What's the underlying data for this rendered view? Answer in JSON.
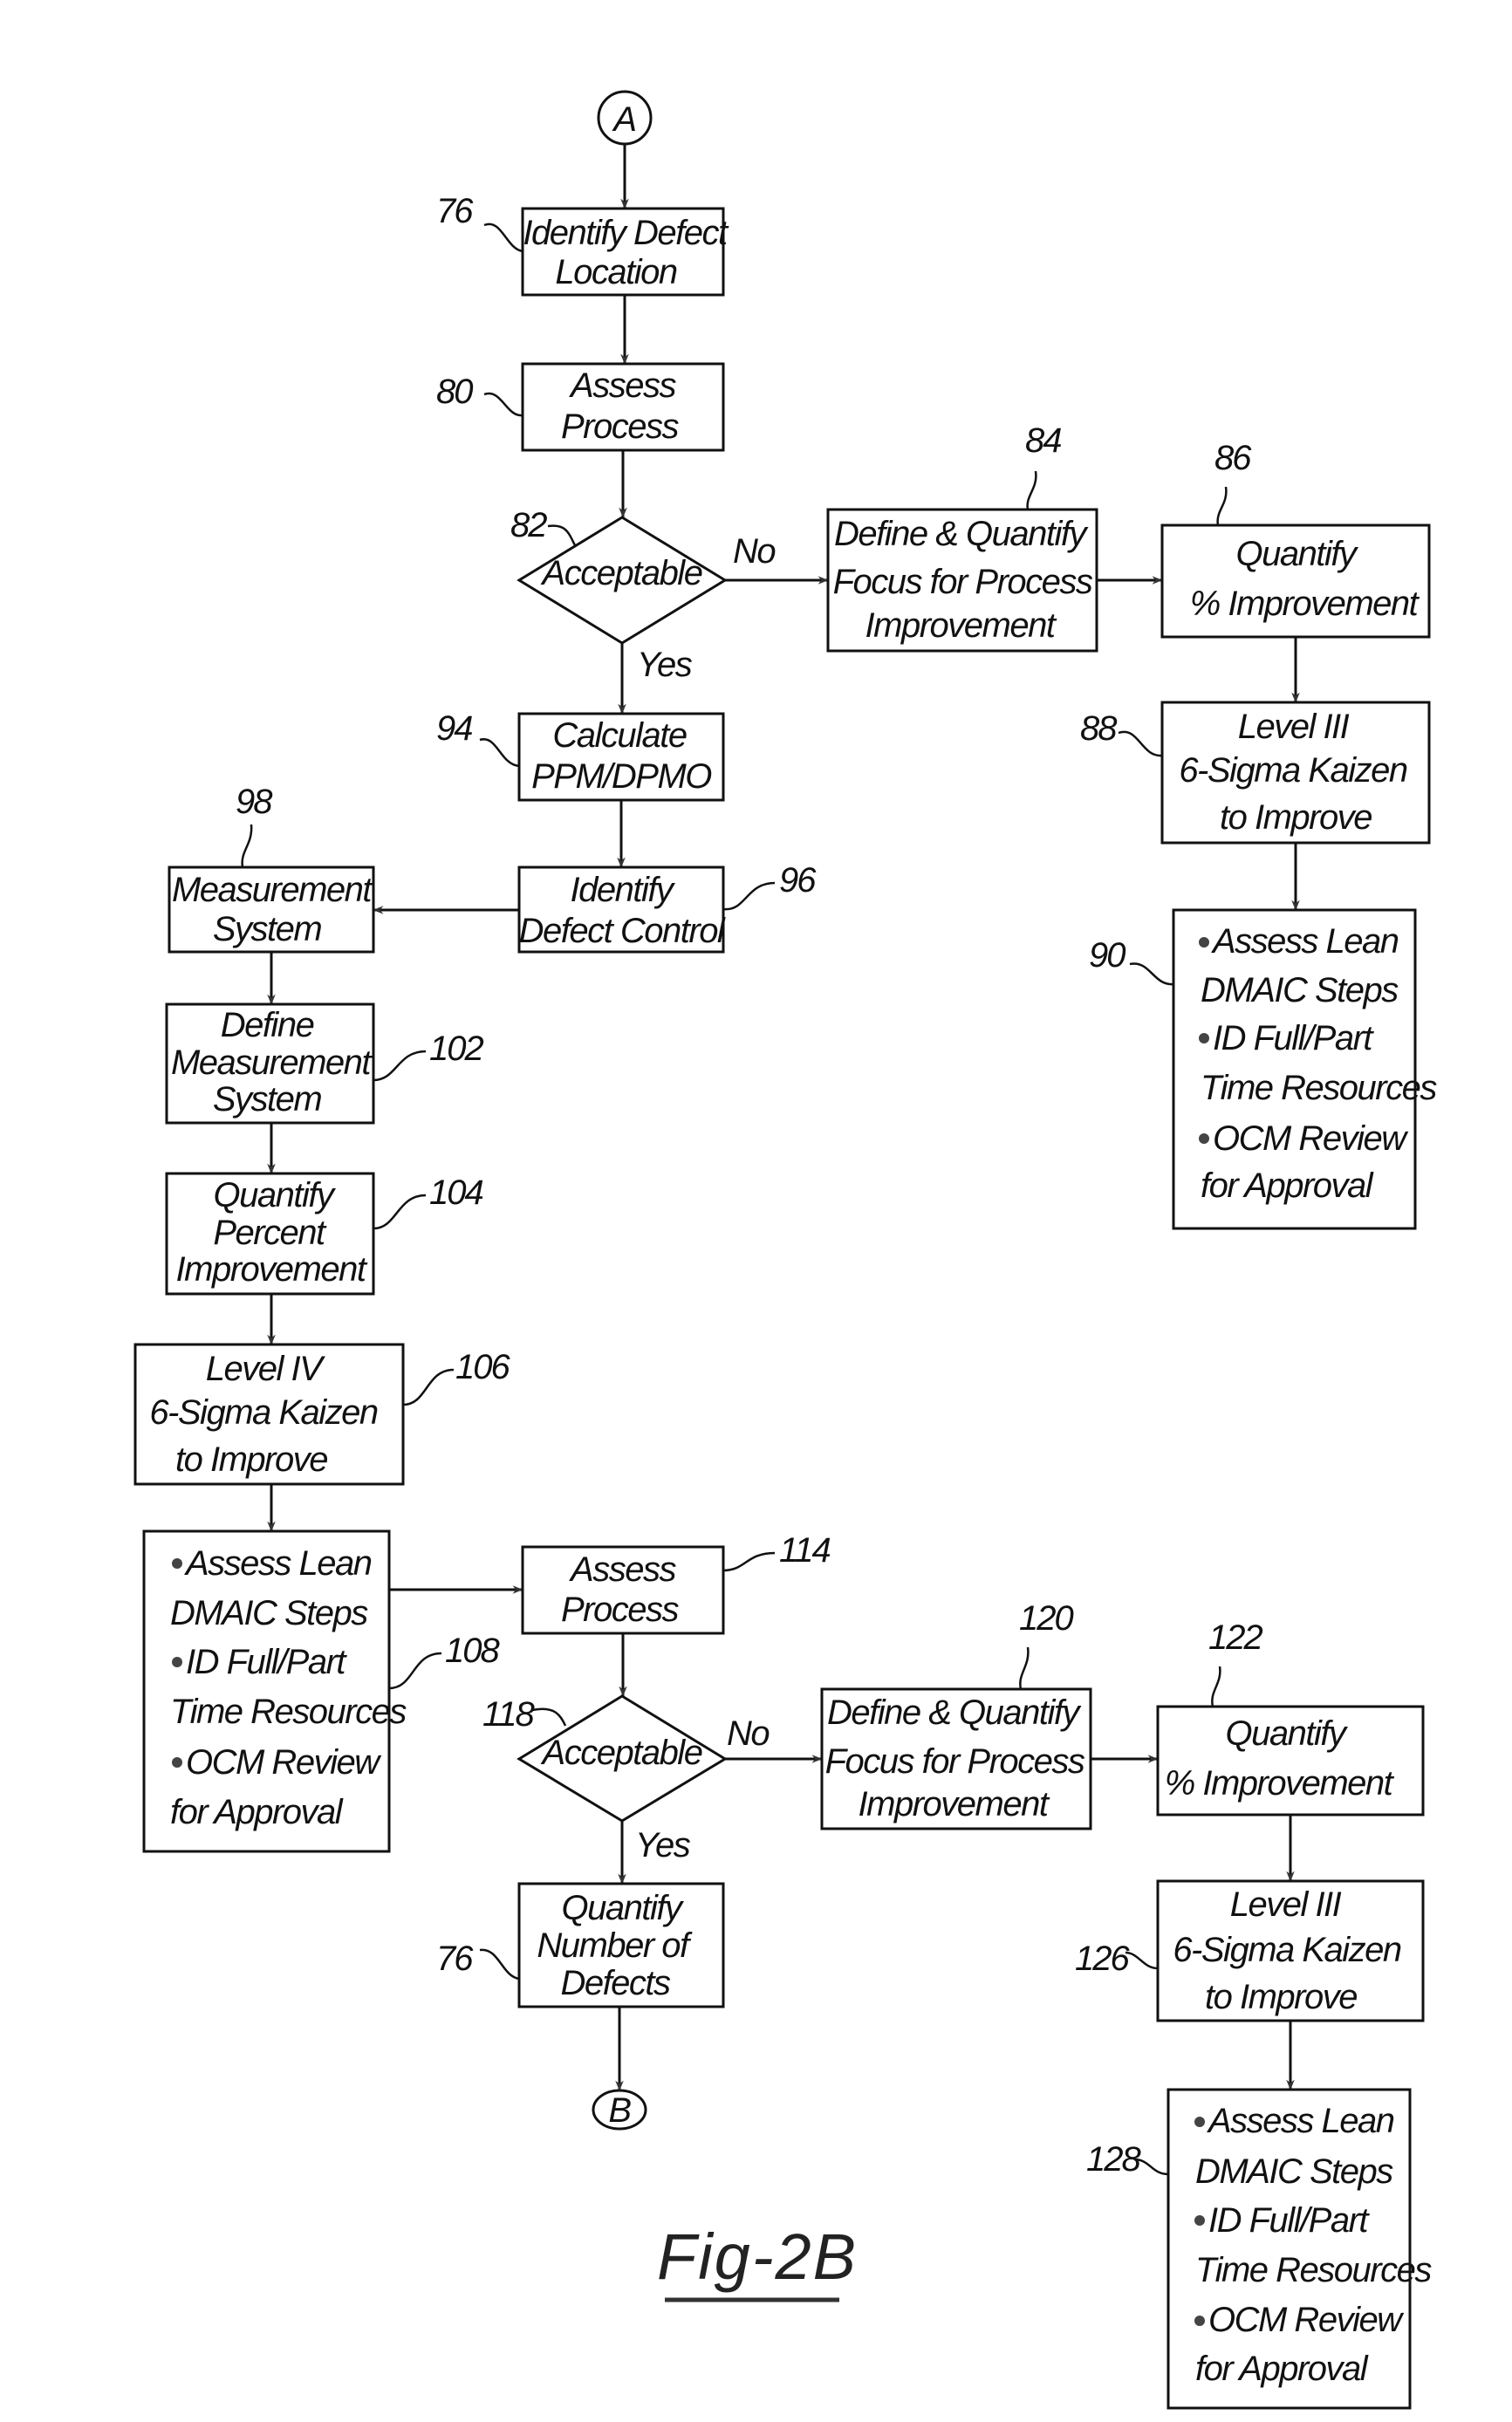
{
  "figure_label": "Fig-2B",
  "connectors": {
    "start": "A",
    "end": "B"
  },
  "nodes": {
    "n76a": {
      "ref": "76",
      "lines": [
        "Identify Defect",
        "Location"
      ]
    },
    "n80": {
      "ref": "80",
      "lines": [
        "Assess",
        "Process"
      ]
    },
    "n82": {
      "ref": "82",
      "lines": [
        "Acceptable"
      ],
      "no_label": "No",
      "yes_label": "Yes"
    },
    "n84": {
      "ref": "84",
      "lines": [
        "Define & Quantify",
        "Focus for Process",
        "Improvement"
      ]
    },
    "n86": {
      "ref": "86",
      "lines": [
        "Quantify",
        "% Improvement"
      ]
    },
    "n88": {
      "ref": "88",
      "lines": [
        "Level III",
        "6-Sigma Kaizen",
        "to Improve"
      ]
    },
    "n90": {
      "ref": "90",
      "lines": [
        "Assess Lean",
        "DMAIC Steps",
        "ID Full/Part",
        "Time Resources",
        "OCM Review",
        "for Approval"
      ]
    },
    "n94": {
      "ref": "94",
      "lines": [
        "Calculate",
        "PPM/DPMO"
      ]
    },
    "n96": {
      "ref": "96",
      "lines": [
        "Identify",
        "Defect Control"
      ]
    },
    "n98": {
      "ref": "98",
      "lines": [
        "Measurement",
        "System"
      ]
    },
    "n102": {
      "ref": "102",
      "lines": [
        "Define",
        "Measurement",
        "System"
      ]
    },
    "n104": {
      "ref": "104",
      "lines": [
        "Quantify",
        "Percent",
        "Improvement"
      ]
    },
    "n106": {
      "ref": "106",
      "lines": [
        "Level IV",
        "6-Sigma Kaizen",
        "to Improve"
      ]
    },
    "n108": {
      "ref": "108",
      "lines": [
        "Assess Lean",
        "DMAIC Steps",
        "ID Full/Part",
        "Time Resources",
        "OCM Review",
        "for Approval"
      ]
    },
    "n114": {
      "ref": "114",
      "lines": [
        "Assess",
        "Process"
      ]
    },
    "n118": {
      "ref": "118",
      "lines": [
        "Acceptable"
      ],
      "no_label": "No",
      "yes_label": "Yes"
    },
    "n120": {
      "ref": "120",
      "lines": [
        "Define & Quantify",
        "Focus for Process",
        "Improvement"
      ]
    },
    "n122": {
      "ref": "122",
      "lines": [
        "Quantify",
        "% Improvement"
      ]
    },
    "n126": {
      "ref": "126",
      "lines": [
        "Level III",
        "6-Sigma Kaizen",
        "to Improve"
      ]
    },
    "n128": {
      "ref": "128",
      "lines": [
        "Assess Lean",
        "DMAIC Steps",
        "ID Full/Part",
        "Time Resources",
        "OCM Review",
        "for Approval"
      ]
    },
    "n76b": {
      "ref": "76",
      "lines": [
        "Quantify",
        "Number of",
        "Defects"
      ]
    }
  }
}
